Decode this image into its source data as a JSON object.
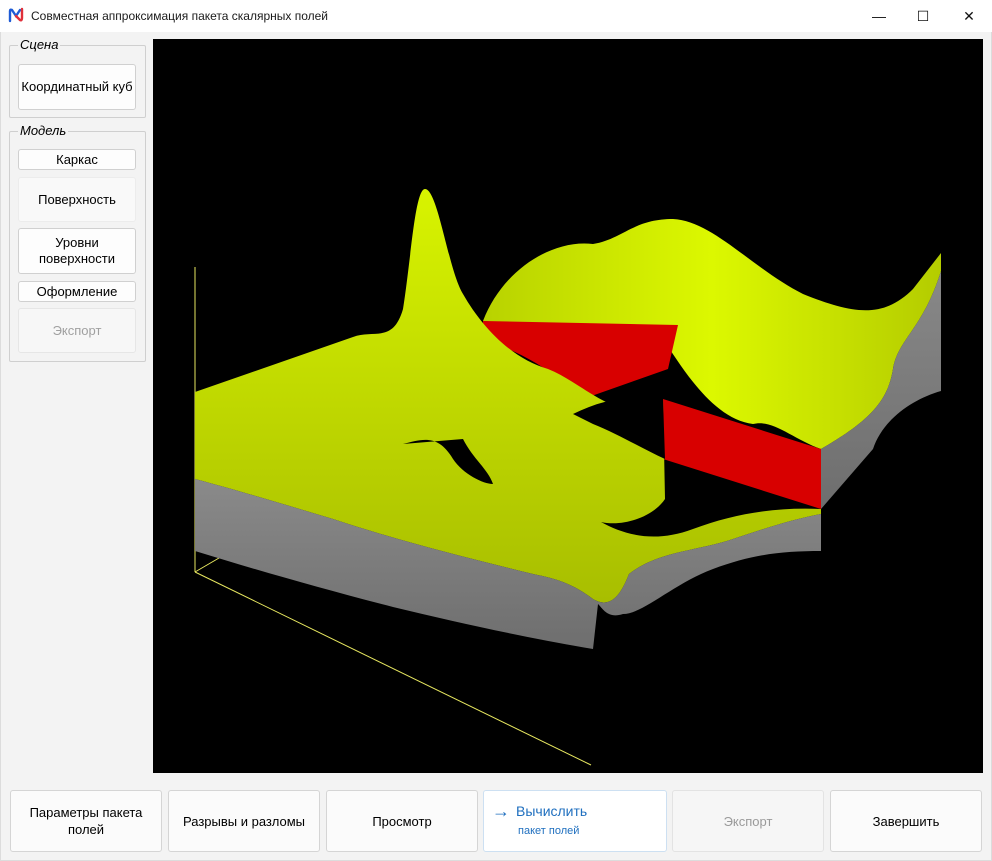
{
  "window": {
    "title": "Совместная аппроксимация пакета скалярных полей",
    "controls": {
      "minimize": "—",
      "maximize": "☐",
      "close": "✕"
    }
  },
  "sidebar": {
    "scene": {
      "legend": "Сцена",
      "buttons": [
        {
          "label": "Координатный куб"
        }
      ]
    },
    "model": {
      "legend": "Модель",
      "buttons": [
        {
          "label": "Каркас",
          "enabled": true
        },
        {
          "label": "Поверхность",
          "enabled": true
        },
        {
          "label": "Уровни поверхности",
          "enabled": true
        },
        {
          "label": "Оформление",
          "enabled": true
        },
        {
          "label": "Экспорт",
          "enabled": false
        }
      ]
    }
  },
  "viewport": {
    "background": "#000000",
    "colors": {
      "surface": "#ccee00",
      "fault": "#dd0000",
      "side": "#7a7a7a",
      "axis": "#e8e860"
    }
  },
  "footer": {
    "buttons": [
      {
        "label": "Параметры пакета полей",
        "enabled": true
      },
      {
        "label": "Разрывы и разломы",
        "enabled": true
      },
      {
        "label": "Просмотр",
        "enabled": true
      },
      {
        "label": "Вычислить",
        "note": "пакет полей",
        "icon": "arrow-right-icon",
        "enabled": true,
        "accent": "#1f6fbf"
      },
      {
        "label": "Экспорт",
        "enabled": false
      },
      {
        "label": "Завершить",
        "enabled": true
      }
    ]
  }
}
